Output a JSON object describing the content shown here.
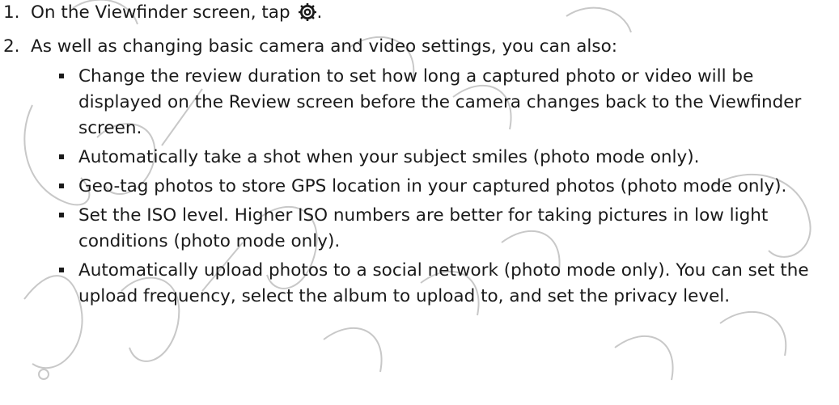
{
  "steps": [
    {
      "number": "1.",
      "text": "On the Viewfinder screen, tap",
      "after": ".",
      "icon": "gear-icon"
    },
    {
      "number": "2.",
      "text": "As well as changing basic camera and video settings, you can also:"
    }
  ],
  "bullets": [
    "Change the review duration to set how long a captured photo or video will be displayed on the Review screen before the camera changes back to the Viewfinder screen.",
    "Automatically take a shot when your subject smiles (photo mode only).",
    "Geo-tag photos to store GPS location in your captured photos (photo mode only).",
    "Set the ISO level. Higher ISO numbers are better for taking pictures in low light conditions (photo mode only).",
    "Automatically upload photos to a social network (photo mode only). You can set the upload frequency, select the album to upload to, and set the privacy level."
  ]
}
